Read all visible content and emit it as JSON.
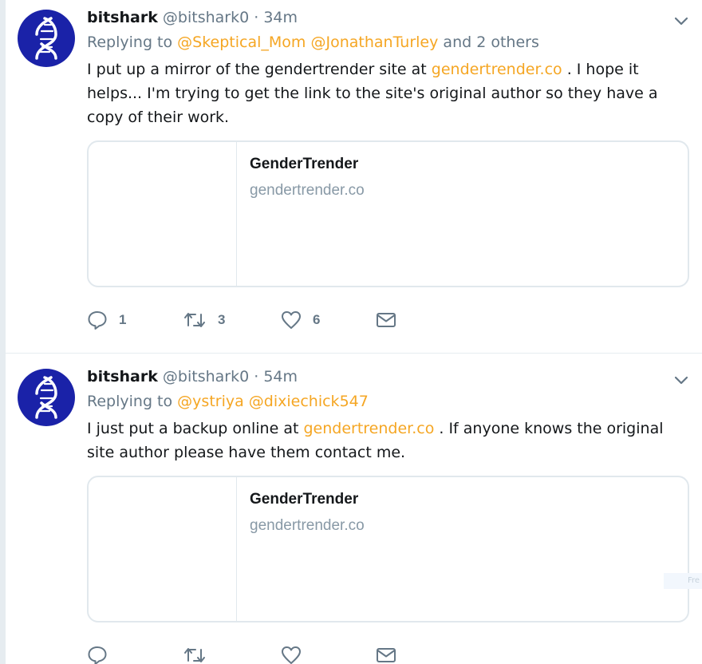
{
  "tweets": [
    {
      "fullname": "bitshark",
      "handle": "@bitshark0",
      "separator": "·",
      "time": "34m",
      "replying_label": "Replying to",
      "mentions": [
        "@Skeptical_Mom",
        "@JonathanTurley"
      ],
      "others": "and 2 others",
      "text_before": "I put up a mirror of the gendertrender site at ",
      "link": "gendertrender.co",
      "text_after": " .  I hope it helps... I'm trying to get the link to the site's original author so they have a copy of their work.",
      "card": {
        "title": "GenderTrender",
        "domain": "gendertrender.co"
      },
      "counts": {
        "replies": "1",
        "retweets": "3",
        "likes": "6"
      }
    },
    {
      "fullname": "bitshark",
      "handle": "@bitshark0",
      "separator": "·",
      "time": "54m",
      "replying_label": "Replying to",
      "mentions": [
        "@ystriya",
        "@dixiechick547"
      ],
      "text_before": "I just put a backup online at ",
      "link": "gendertrender.co",
      "text_after": " .  If anyone knows the original site author please have them contact me.",
      "card": {
        "title": "GenderTrender",
        "domain": "gendertrender.co"
      }
    }
  ],
  "ghost_text": "Fre",
  "icons": {
    "reply": "reply-icon",
    "retweet": "retweet-icon",
    "like": "heart-icon",
    "dm": "envelope-icon",
    "caret": "chevron-down-icon",
    "avatar": "dna-helix-icon"
  },
  "colors": {
    "link": "#f5a623",
    "meta": "#657786",
    "avatar_bg": "#1a22a8",
    "border": "#e1e8ed"
  }
}
